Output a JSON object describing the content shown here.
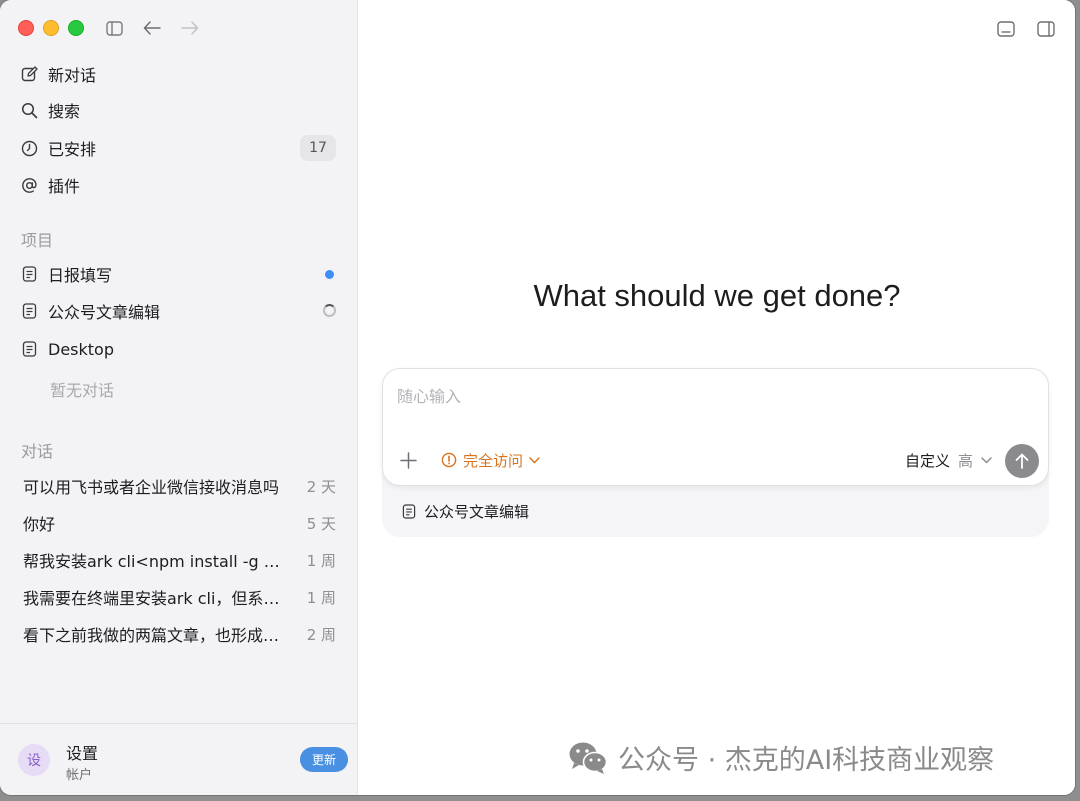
{
  "sidebar": {
    "nav": [
      {
        "label": "新对话",
        "icon": "edit-icon"
      },
      {
        "label": "搜索",
        "icon": "search-icon"
      },
      {
        "label": "已安排",
        "icon": "clock-icon",
        "count": "17"
      },
      {
        "label": "插件",
        "icon": "at-icon"
      }
    ],
    "projects_label": "项目",
    "projects": [
      {
        "label": "日报填写",
        "icon": "document-icon",
        "status": "unread-dot"
      },
      {
        "label": "公众号文章编辑",
        "icon": "document-icon",
        "status": "loading-spinner"
      },
      {
        "label": "Desktop",
        "icon": "document-icon"
      }
    ],
    "projects_empty": "暂无对话",
    "conversations_label": "对话",
    "conversations": [
      {
        "title": "可以用飞书或者企业微信接收消息吗",
        "time": "2 天"
      },
      {
        "title": "你好",
        "time": "5 天"
      },
      {
        "title": "帮我安装ark cli<npm install -g @volcengine/ark-cli>",
        "time": "1 周"
      },
      {
        "title": "我需要在终端里安装ark cli，但系统提示权限不足",
        "time": "1 周"
      },
      {
        "title": "看下之前我做的两篇文章，也形成一个模板",
        "time": "2 周"
      }
    ],
    "footer": {
      "avatar": "设",
      "title": "设置",
      "subtitle": "帐户",
      "update_label": "更新"
    }
  },
  "main": {
    "hero": "What should we get done?",
    "composer": {
      "placeholder": "随心输入",
      "access_label": "完全访问",
      "model_label": "自定义",
      "level_label": "高"
    },
    "project_chip": "公众号文章编辑"
  },
  "watermark": "公众号 · 杰克的AI科技商业观察",
  "colors": {
    "accent_orange": "#d9731c",
    "update_blue": "#4a90e2",
    "dot_blue": "#3d8ef5"
  }
}
